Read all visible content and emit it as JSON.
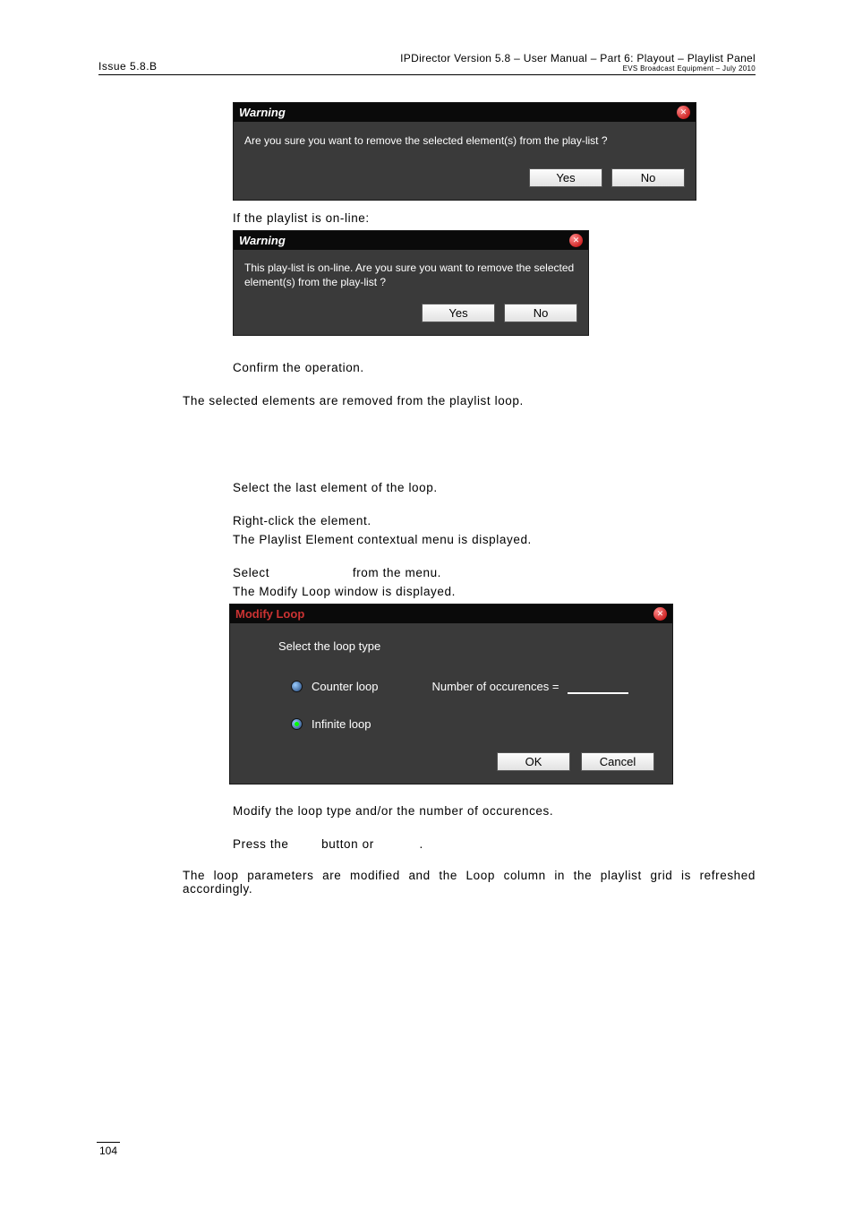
{
  "header": {
    "issue": "Issue 5.8.B",
    "right1": "IPDirector Version 5.8 – User Manual – Part 6: Playout – Playlist Panel",
    "right2": "EVS Broadcast Equipment – July 2010"
  },
  "warning1": {
    "title": "Warning",
    "message": "Are you sure you want to remove the selected element(s) from the play-list ?",
    "yes": "Yes",
    "no": "No"
  },
  "text_online": "If the playlist is on-line:",
  "warning2": {
    "title": "Warning",
    "message": "This play-list is on-line. Are you sure you want to remove the selected element(s) from the play-list ?",
    "yes": "Yes",
    "no": "No"
  },
  "confirm_op": "Confirm the operation.",
  "removed": "The selected elements are removed from the playlist loop.",
  "select_last": "Select the last element of the loop.",
  "right_click": "Right-click the element.",
  "contextual": "The Playlist Element contextual menu is displayed.",
  "select_from_menu_pre": "Select ",
  "select_from_menu_post": " from the menu.",
  "modify_shown": "The Modify Loop window is displayed.",
  "modifyloop": {
    "title": "Modify Loop",
    "select_type": "Select the loop type",
    "counter": "Counter loop",
    "occ": "Number of occurences =",
    "infinite": "Infinite loop",
    "ok": "OK",
    "cancel": "Cancel"
  },
  "modify_type": "Modify the loop type and/or the number of occurences.",
  "press_pre": "Press the ",
  "press_mid": " button or ",
  "press_post": ".",
  "loop_params": "The loop parameters are modified and the Loop column in the playlist grid is refreshed accordingly.",
  "page_num": "104"
}
